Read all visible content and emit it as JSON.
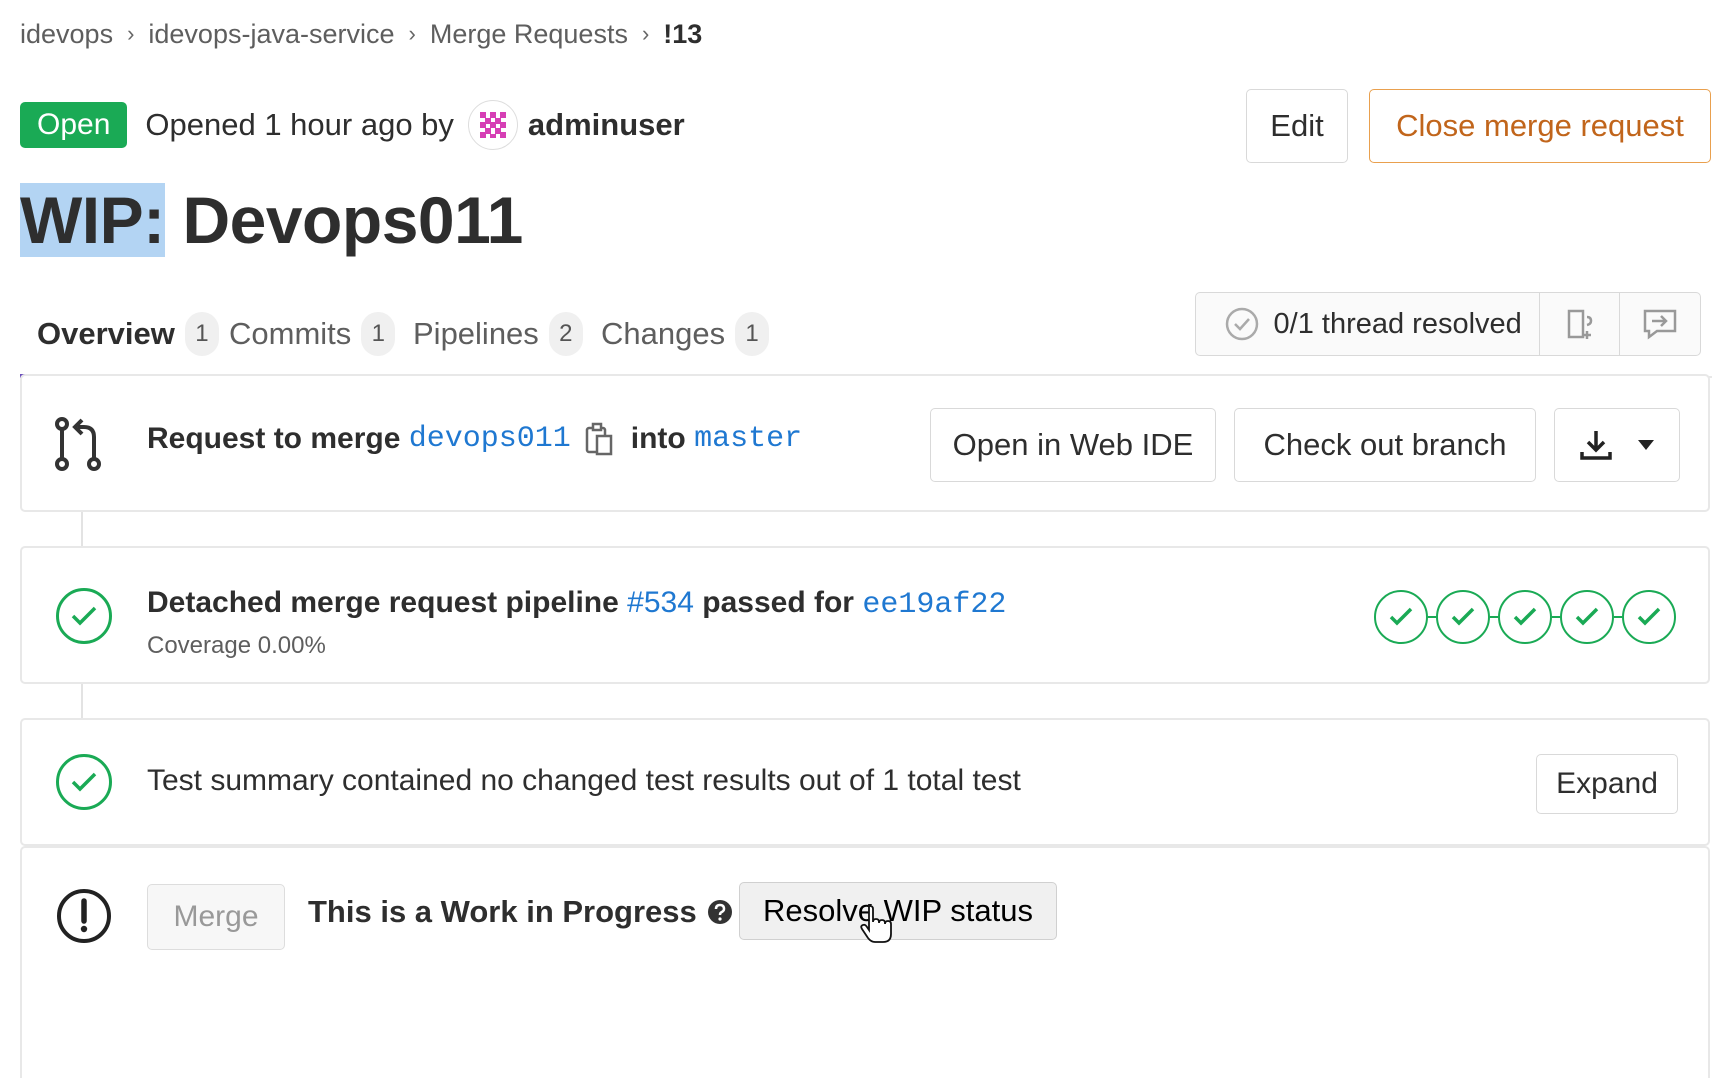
{
  "breadcrumb": {
    "items": [
      "idevops",
      "idevops-java-service",
      "Merge Requests",
      "!13"
    ]
  },
  "header": {
    "status": "Open",
    "opened_text": "Opened 1 hour ago by",
    "author": "adminuser",
    "edit_label": "Edit",
    "close_label": "Close merge request"
  },
  "title": {
    "prefix": "WIP:",
    "name": "Devops011"
  },
  "tabs": [
    {
      "label": "Overview",
      "count": "1",
      "active": true
    },
    {
      "label": "Commits",
      "count": "1"
    },
    {
      "label": "Pipelines",
      "count": "2"
    },
    {
      "label": "Changes",
      "count": "1"
    }
  ],
  "threads": {
    "status": "0/1 thread resolved"
  },
  "merge_info": {
    "prefix": "Request to merge",
    "source_branch": "devops011",
    "into": "into",
    "target_branch": "master",
    "web_ide_label": "Open in Web IDE",
    "checkout_label": "Check out branch"
  },
  "pipeline": {
    "prefix": "Detached merge request pipeline",
    "id": "#534",
    "middle": "passed for",
    "commit": "ee19af22",
    "coverage": "Coverage 0.00%",
    "stage_count": 5
  },
  "test_summary": {
    "text": "Test summary contained no changed test results out of 1 total test",
    "expand_label": "Expand"
  },
  "wip": {
    "merge_label": "Merge",
    "text": "This is a Work in Progress",
    "resolve_label": "Resolve WIP status"
  },
  "colors": {
    "success": "#1aaa55",
    "link": "#1f78d1",
    "tab_active": "#6b4fbb",
    "close_border": "#e9a04e"
  }
}
